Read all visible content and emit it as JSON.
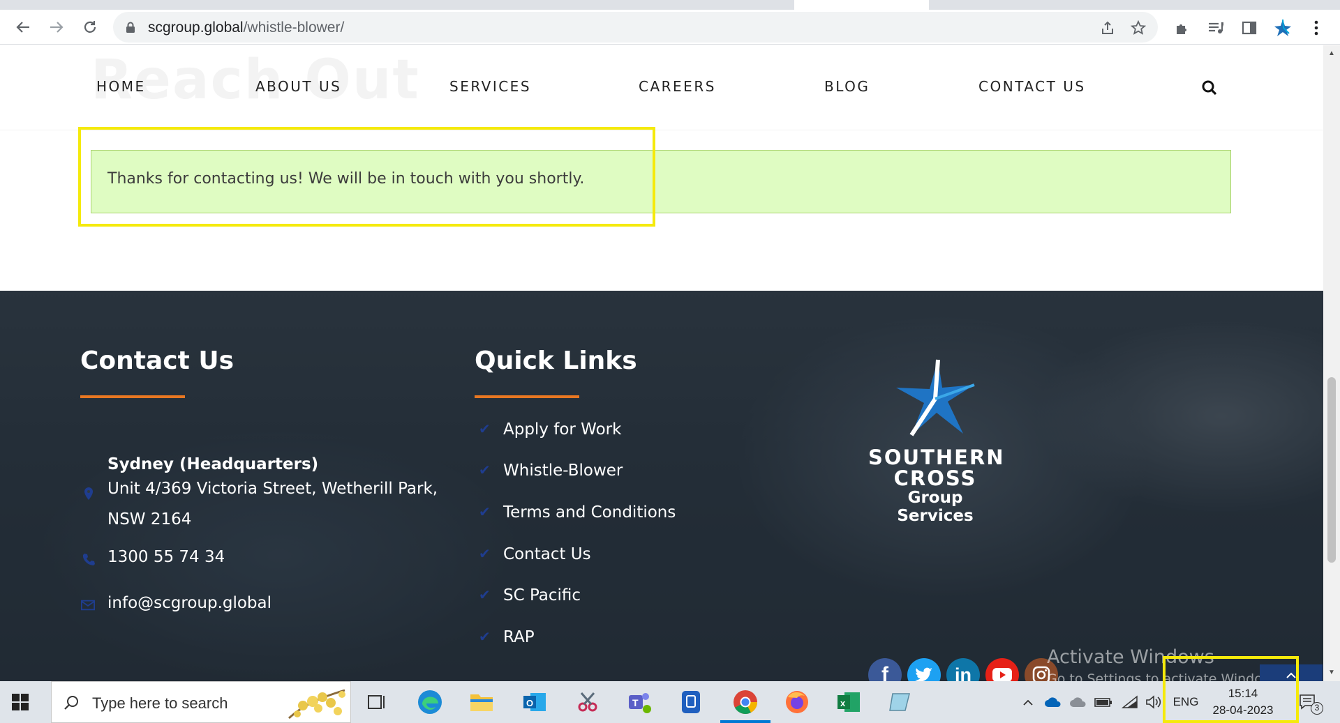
{
  "browser": {
    "url_host": "scgroup.global",
    "url_path": "/whistle-blower/"
  },
  "page": {
    "ghost_title": "Reach Out",
    "nav": [
      "HOME",
      "ABOUT US",
      "SERVICES",
      "CAREERS",
      "BLOG",
      "CONTACT US"
    ],
    "notice": "Thanks for contacting us! We will be in touch with you shortly."
  },
  "footer": {
    "contact": {
      "title": "Contact Us",
      "office": "Sydney (Headquarters)",
      "address_line1": "Unit 4/369 Victoria Street, Wetherill Park,",
      "address_line2": "NSW 2164",
      "phone": "1300 55 74 34",
      "email": "info@scgroup.global"
    },
    "quick_links": {
      "title": "Quick Links",
      "items": [
        "Apply for Work",
        "Whistle-Blower",
        "Terms and Conditions",
        "Contact Us",
        "SC Pacific",
        "RAP"
      ]
    },
    "logo": {
      "line1": "SOUTHERN",
      "line2": "CROSS",
      "line3": "Group Services"
    },
    "social": [
      "facebook",
      "twitter",
      "linkedin",
      "youtube",
      "instagram"
    ]
  },
  "watermark": {
    "title": "Activate Windows",
    "subtitle": "Go to Settings to activate Windows."
  },
  "taskbar": {
    "search_placeholder": "Type here to search",
    "language": "ENG",
    "time": "15:14",
    "date": "28-04-2023",
    "notification_count": "3"
  },
  "colors": {
    "accent_orange": "#e87722",
    "notice_bg": "#dffcc2",
    "highlight": "#f5ea0b",
    "check_blue": "#1f3d8f"
  }
}
